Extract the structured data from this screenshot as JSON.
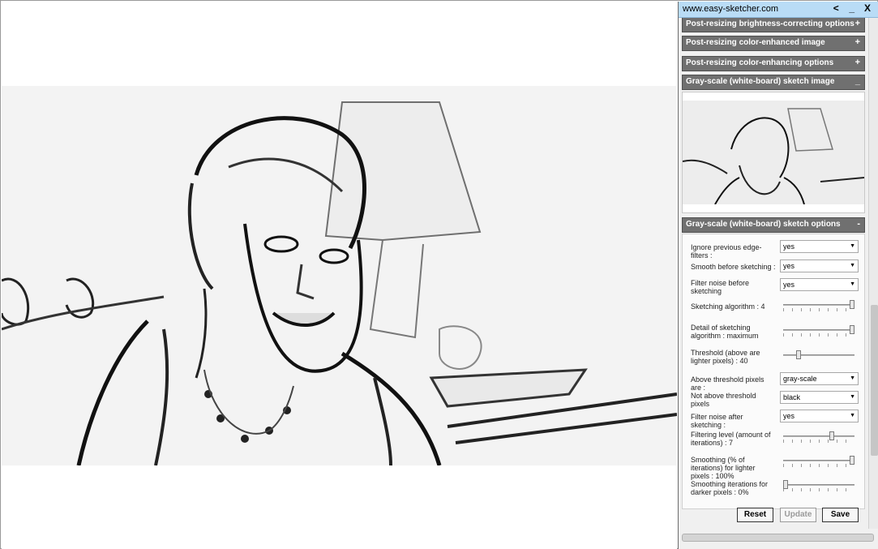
{
  "window": {
    "title": "www.easy-sketcher.com",
    "back_glyph": "<",
    "minimize_glyph": "_",
    "close_glyph": "X"
  },
  "sections": [
    {
      "label": "Post-resizing brightness-correcting options",
      "toggle": "+"
    },
    {
      "label": "Post-resizing color-enhanced image",
      "toggle": "+"
    },
    {
      "label": "Post-resizing color-enhancing options",
      "toggle": "+"
    },
    {
      "label": "Gray-scale (white-board) sketch image",
      "toggle": "_"
    },
    {
      "label": "Gray-scale (white-board) sketch options",
      "toggle": "-"
    }
  ],
  "options": {
    "ignore_edge": {
      "label": "Ignore previous edge-filters :",
      "value": "yes"
    },
    "smooth_before": {
      "label": "Smooth before sketching :",
      "value": "yes"
    },
    "filter_before": {
      "label": "Filter noise before sketching",
      "value": "yes"
    },
    "algorithm": {
      "label": "Sketching algorithm : 4",
      "level": 1.0
    },
    "detail": {
      "label": "Detail of sketching algorithm : maximum",
      "level": 1.0
    },
    "threshold": {
      "label": "Threshold (above are lighter pixels) : 40",
      "level": 0.2
    },
    "above_pixels": {
      "label": "Above threshold pixels are :",
      "value": "gray-scale"
    },
    "not_above": {
      "label": "Not above threshold pixels",
      "value": "black"
    },
    "filter_after": {
      "label": "Filter noise after sketching :",
      "value": "yes"
    },
    "filter_level": {
      "label": "Filtering level (amount of iterations) : 7",
      "level": 0.7
    },
    "smooth_light": {
      "label": "Smoothing (% of iterations) for lighter pixels : 100%",
      "level": 1.0
    },
    "smooth_dark": {
      "label": "Smoothing iterations for darker pixels : 0%",
      "level": 0.0
    }
  },
  "buttons": {
    "reset": "Reset",
    "update": "Update",
    "save": "Save"
  },
  "icons": {
    "dropdown": "chevron-down-icon"
  }
}
